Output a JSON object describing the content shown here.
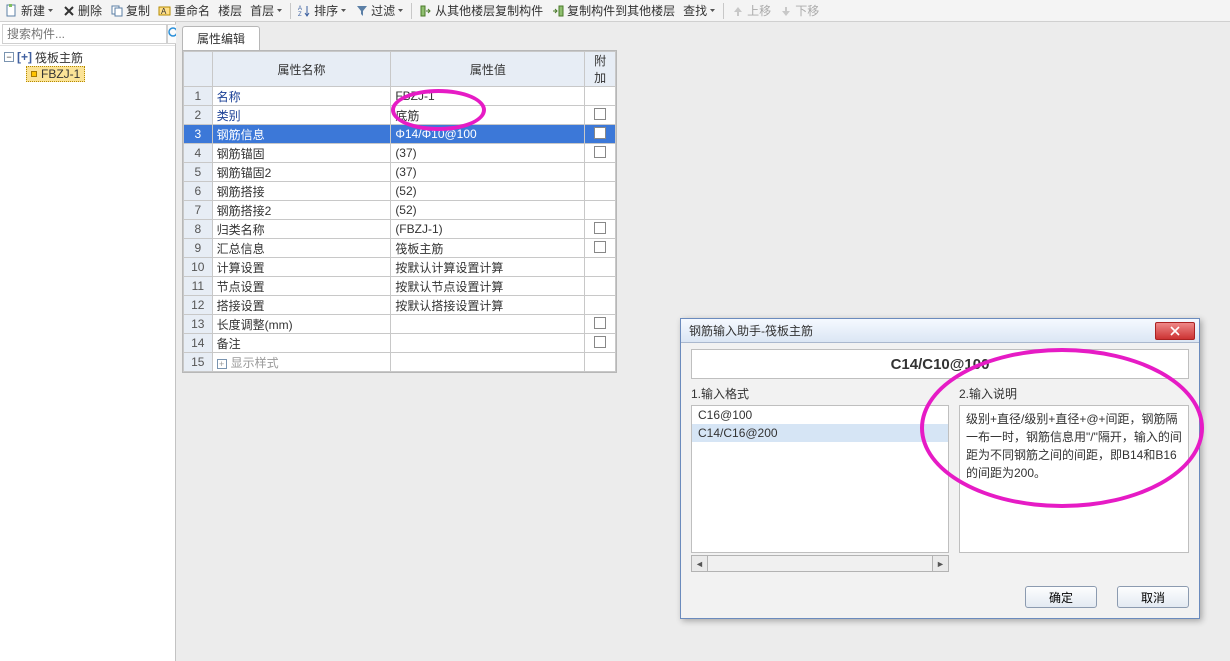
{
  "toolbar": {
    "new": "新建",
    "delete": "删除",
    "copy": "复制",
    "rename": "重命名",
    "layer": "楼层",
    "home": "首层",
    "sort": "排序",
    "filter": "过滤",
    "copy_from_other": "从其他楼层复制构件",
    "copy_to_other": "复制构件到其他楼层",
    "find": "查找",
    "move_up": "上移",
    "move_down": "下移"
  },
  "search": {
    "placeholder": "搜索构件..."
  },
  "tree": {
    "root": "筏板主筋",
    "child": "FBZJ-1"
  },
  "tab": {
    "label": "属性编辑"
  },
  "grid": {
    "headers": {
      "name": "属性名称",
      "value": "属性值",
      "attach": "附加"
    },
    "rows": [
      {
        "n": "1",
        "name": "名称",
        "value": "FBZJ-1",
        "link": true,
        "attach": ""
      },
      {
        "n": "2",
        "name": "类别",
        "value": "底筋",
        "link": true,
        "attach": "chk"
      },
      {
        "n": "3",
        "name": "钢筋信息",
        "value": "Φ14/Φ10@100",
        "selected": true,
        "attach": "chk"
      },
      {
        "n": "4",
        "name": "钢筋锚固",
        "value": "(37)",
        "attach": "chk"
      },
      {
        "n": "5",
        "name": "钢筋锚固2",
        "value": "(37)",
        "attach": ""
      },
      {
        "n": "6",
        "name": "钢筋搭接",
        "value": "(52)",
        "attach": ""
      },
      {
        "n": "7",
        "name": "钢筋搭接2",
        "value": "(52)",
        "attach": ""
      },
      {
        "n": "8",
        "name": "归类名称",
        "value": "(FBZJ-1)",
        "attach": "chk"
      },
      {
        "n": "9",
        "name": "汇总信息",
        "value": "筏板主筋",
        "attach": "chk"
      },
      {
        "n": "10",
        "name": "计算设置",
        "value": "按默认计算设置计算",
        "attach": ""
      },
      {
        "n": "11",
        "name": "节点设置",
        "value": "按默认节点设置计算",
        "attach": ""
      },
      {
        "n": "12",
        "name": "搭接设置",
        "value": "按默认搭接设置计算",
        "attach": ""
      },
      {
        "n": "13",
        "name": "长度调整(mm)",
        "value": "",
        "attach": "chk"
      },
      {
        "n": "14",
        "name": "备注",
        "value": "",
        "attach": "chk"
      },
      {
        "n": "15",
        "name": "显示样式",
        "value": "",
        "gray": true,
        "expand": true,
        "attach": ""
      }
    ]
  },
  "dialog": {
    "title": "钢筋输入助手-筏板主筋",
    "display": "C14/C10@100",
    "section1_label": "1.输入格式",
    "section2_label": "2.输入说明",
    "formats": [
      "C16@100",
      "C14/C16@200"
    ],
    "explanation": "级别+直径/级别+直径+@+间距，钢筋隔一布一时，钢筋信息用\"/\"隔开，输入的间距为不同钢筋之间的间距，即B14和B16的间距为200。",
    "ok": "确定",
    "cancel": "取消"
  }
}
